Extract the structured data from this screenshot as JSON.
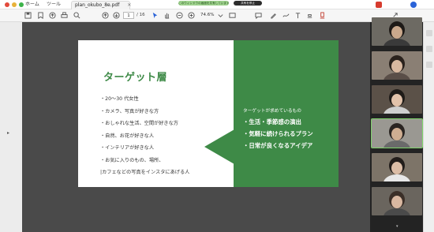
{
  "window": {
    "tabs": [
      {
        "label": "ホーム"
      },
      {
        "label": "ツール"
      },
      {
        "label": "plan_okubo_8e.pdf",
        "active": true
      }
    ],
    "banner_left": "このウィンドウの画面を共有しています",
    "banner_right": "共有を停止",
    "dot_colors": [
      "#e24a3b",
      "#e8b23a",
      "#3db34a"
    ]
  },
  "toolbar": {
    "page_current": "1",
    "page_total": "/ 16",
    "zoom": "74.6%",
    "icons": [
      "save-icon",
      "bookmark-icon",
      "upload-icon",
      "print-icon",
      "search-icon",
      "prev-page-icon",
      "next-page-icon",
      "select-icon",
      "hand-icon",
      "zoom-out-icon",
      "zoom-in-icon",
      "zoom-dropdown-icon",
      "fit-icon",
      "comment-icon",
      "pen-icon",
      "draw-icon",
      "text-icon",
      "stamp-icon",
      "more-icon",
      "share-icon"
    ]
  },
  "slide": {
    "title": "ターゲット層",
    "bullets": [
      "・20〜30 代女性",
      "・カメラ、写真が好きな方",
      "・おしゃれな生活、空間が好きな方",
      "・自然、お花が好きな人",
      "・インテリアが好きな人",
      "・お気に入りのもの、場所、",
      "|カフェなどの写真をインスタにあげる人"
    ],
    "needs_heading": "ターゲットが求めているもの",
    "needs": [
      "・生活・季節感の演出",
      "・気軽に続けられるプラン",
      "・日常が良くなるアイデア"
    ],
    "accent_color": "#3e8a47"
  },
  "participants": [
    {
      "name": "participant-1",
      "bg": "#6d6a63",
      "skin": "#c9a88c",
      "hair": "#1e1a17",
      "shirt": "#3a3a3a"
    },
    {
      "name": "participant-2",
      "bg": "#8a7f74",
      "skin": "#d8b8a0",
      "hair": "#2a221d",
      "shirt": "#5a4e48"
    },
    {
      "name": "participant-3",
      "bg": "#5b5148",
      "skin": "#e2c2aa",
      "hair": "#1f1b18",
      "shirt": "#cfcfcf"
    },
    {
      "name": "participant-4",
      "bg": "#9a9892",
      "skin": "#cfae92",
      "hair": "#2a2522",
      "shirt": "#6a6a6a",
      "active": true
    },
    {
      "name": "participant-5",
      "bg": "#7d7468",
      "skin": "#dcbda6",
      "hair": "#221d1a",
      "shirt": "#e8e8e8"
    },
    {
      "name": "participant-6",
      "bg": "#6a655e",
      "skin": "#d9b8a1",
      "hair": "#3b2f28",
      "shirt": "#4a4a4a"
    }
  ]
}
